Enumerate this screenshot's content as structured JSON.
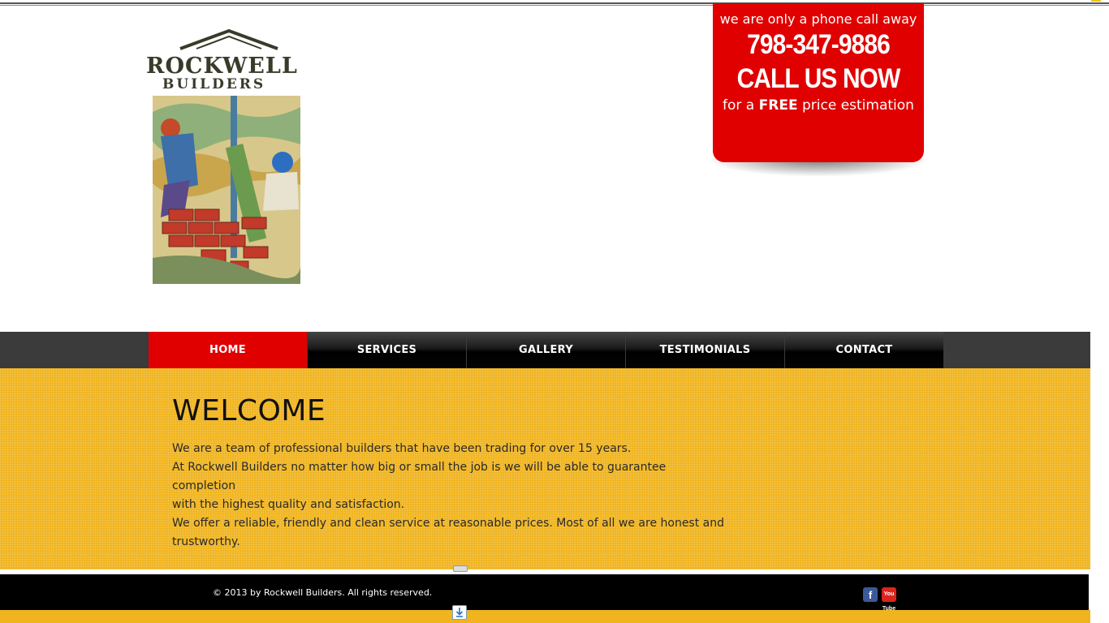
{
  "brand": {
    "line1": "ROCKWELL",
    "line2": "BUILDERS"
  },
  "phone_banner": {
    "line1": "we are only a phone call away",
    "phone": "798-347-9886",
    "cta": "CALL US NOW",
    "line4_prefix": "for a ",
    "line4_bold": "FREE",
    "line4_suffix": " price estimation",
    "color": "#e00000"
  },
  "nav": {
    "items": [
      {
        "label": "HOME"
      },
      {
        "label": "SERVICES"
      },
      {
        "label": "GALLERY"
      },
      {
        "label": "TESTIMONIALS"
      },
      {
        "label": "CONTACT"
      }
    ]
  },
  "welcome": {
    "title": "WELCOME",
    "lines": [
      "We are a team of professional builders that have been trading for over 15 years.",
      "At Rockwell Builders no matter how big or small the job is we will be able to guarantee completion",
      "with the highest quality and satisfaction.",
      "We offer a reliable, friendly and clean service at reasonable prices. Most of all we are honest and",
      "trustworthy."
    ]
  },
  "footer": {
    "copyright": "© 2013 by Rockwell Builders. All rights reserved.",
    "facebook_glyph": "f",
    "youtube_glyph": "You Tube",
    "social_icons": [
      "facebook-icon",
      "youtube-icon"
    ]
  },
  "colors": {
    "accent_red": "#e00000",
    "main_yellow": "#f0b41f",
    "nav_dark": "#000000"
  }
}
